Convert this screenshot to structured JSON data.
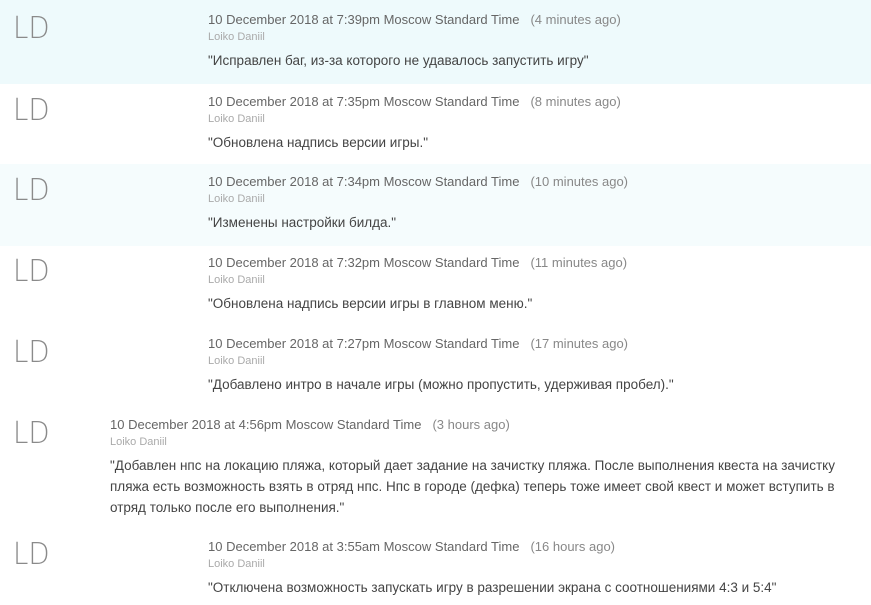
{
  "commits": [
    {
      "avatar": "LD",
      "timestamp": "10 December 2018 at 7:39pm Moscow Standard Time",
      "relative": "(4 minutes ago)",
      "author": "Loiko Daniil",
      "message": "\"Исправлен баг, из-за которого не удавалось запустить игру\""
    },
    {
      "avatar": "LD",
      "timestamp": "10 December 2018 at 7:35pm Moscow Standard Time",
      "relative": "(8 minutes ago)",
      "author": "Loiko Daniil",
      "message": "\"Обновлена надпись версии игры.\""
    },
    {
      "avatar": "LD",
      "timestamp": "10 December 2018 at 7:34pm Moscow Standard Time",
      "relative": "(10 minutes ago)",
      "author": "Loiko Daniil",
      "message": "\"Изменены настройки билда.\""
    },
    {
      "avatar": "LD",
      "timestamp": "10 December 2018 at 7:32pm Moscow Standard Time",
      "relative": "(11 minutes ago)",
      "author": "Loiko Daniil",
      "message": "\"Обновлена надпись версии игры в главном меню.\""
    },
    {
      "avatar": "LD",
      "timestamp": "10 December 2018 at 7:27pm Moscow Standard Time",
      "relative": "(17 minutes ago)",
      "author": "Loiko Daniil",
      "message": "\"Добавлено интро в начале игры (можно пропустить, удерживая пробел).\""
    },
    {
      "avatar": "LD",
      "timestamp": "10 December 2018 at 4:56pm Moscow Standard Time",
      "relative": "(3 hours ago)",
      "author": "Loiko Daniil",
      "message": "\"Добавлен нпс на локацию пляжа, который дает задание на зачистку пляжа. После выполнения квеста на зачистку пляжа есть возможность взять в отряд нпс. Нпс в городе (дефка) теперь тоже имеет свой квест и может вступить в отряд только после его выполнения.\""
    },
    {
      "avatar": "LD",
      "timestamp": "10 December 2018 at 3:55am Moscow Standard Time",
      "relative": "(16 hours ago)",
      "author": "Loiko Daniil",
      "message": "\"Отключена возможность запускать игру в разрешении экрана с соотношениями 4:3 и 5:4\""
    }
  ]
}
